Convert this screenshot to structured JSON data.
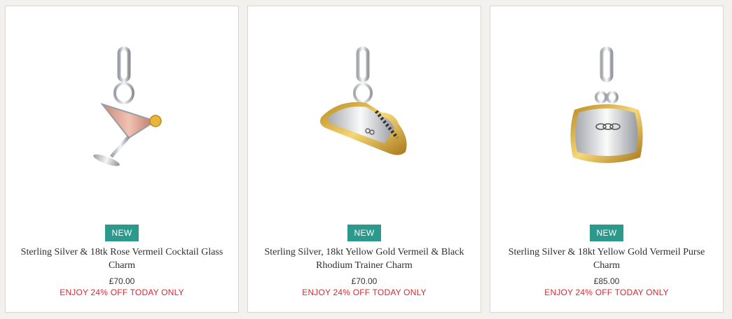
{
  "products": [
    {
      "badge": "NEW",
      "name": "Sterling Silver & 18tk Rose Vermeil Cocktail Glass Charm",
      "price": "£70.00",
      "promo": "ENJOY 24% OFF TODAY ONLY",
      "image_icon": "cocktail-glass-charm"
    },
    {
      "badge": "NEW",
      "name": "Sterling Silver, 18kt Yellow Gold Vermeil & Black Rhodium Trainer Charm",
      "price": "£70.00",
      "promo": "ENJOY 24% OFF TODAY ONLY",
      "image_icon": "trainer-charm"
    },
    {
      "badge": "NEW",
      "name": "Sterling Silver & 18kt Yellow Gold Vermeil Purse Charm",
      "price": "£85.00",
      "promo": "ENJOY 24% OFF TODAY ONLY",
      "image_icon": "purse-charm"
    }
  ],
  "colors": {
    "badge": "#2b9a8c",
    "promo": "#d22b34",
    "background": "#f3f1ee"
  }
}
